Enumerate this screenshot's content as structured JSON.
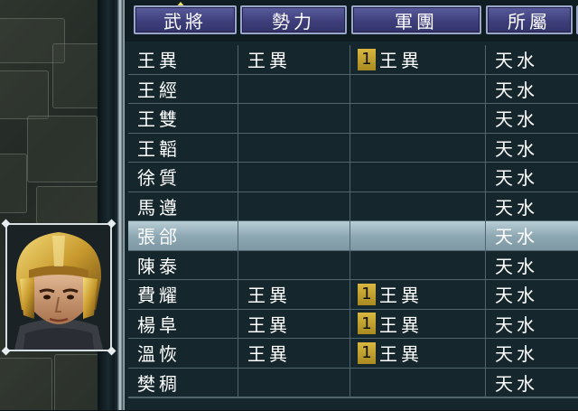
{
  "table": {
    "headers": [
      "武將",
      "勢力",
      "軍團",
      "所屬"
    ],
    "sort_column": "武將",
    "rows": [
      {
        "name": "王異",
        "force": "王異",
        "corps_num": "1",
        "corps": "王異",
        "belong": "天水"
      },
      {
        "name": "王經",
        "force": "",
        "corps_num": "",
        "corps": "",
        "belong": "天水"
      },
      {
        "name": "王雙",
        "force": "",
        "corps_num": "",
        "corps": "",
        "belong": "天水"
      },
      {
        "name": "王韜",
        "force": "",
        "corps_num": "",
        "corps": "",
        "belong": "天水"
      },
      {
        "name": "徐質",
        "force": "",
        "corps_num": "",
        "corps": "",
        "belong": "天水"
      },
      {
        "name": "馬遵",
        "force": "",
        "corps_num": "",
        "corps": "",
        "belong": "天水"
      },
      {
        "name": "張郃",
        "force": "",
        "corps_num": "",
        "corps": "",
        "belong": "天水"
      },
      {
        "name": "陳泰",
        "force": "",
        "corps_num": "",
        "corps": "",
        "belong": "天水"
      },
      {
        "name": "費耀",
        "force": "王異",
        "corps_num": "1",
        "corps": "王異",
        "belong": "天水"
      },
      {
        "name": "楊阜",
        "force": "王異",
        "corps_num": "1",
        "corps": "王異",
        "belong": "天水"
      },
      {
        "name": "溫恢",
        "force": "王異",
        "corps_num": "1",
        "corps": "王異",
        "belong": "天水"
      },
      {
        "name": "樊稠",
        "force": "",
        "corps_num": "",
        "corps": "",
        "belong": "天水"
      }
    ],
    "selected_index": 6
  },
  "colors": {
    "header_bg": "#3e3e7c",
    "row_bg": "#15262c",
    "selected_bg": "#9fb8c2",
    "badge": "#c8a830",
    "text": "#ffffff"
  },
  "portrait": {
    "icon": "officer-portrait-icon"
  },
  "map": {
    "icon": "terrain-map"
  }
}
